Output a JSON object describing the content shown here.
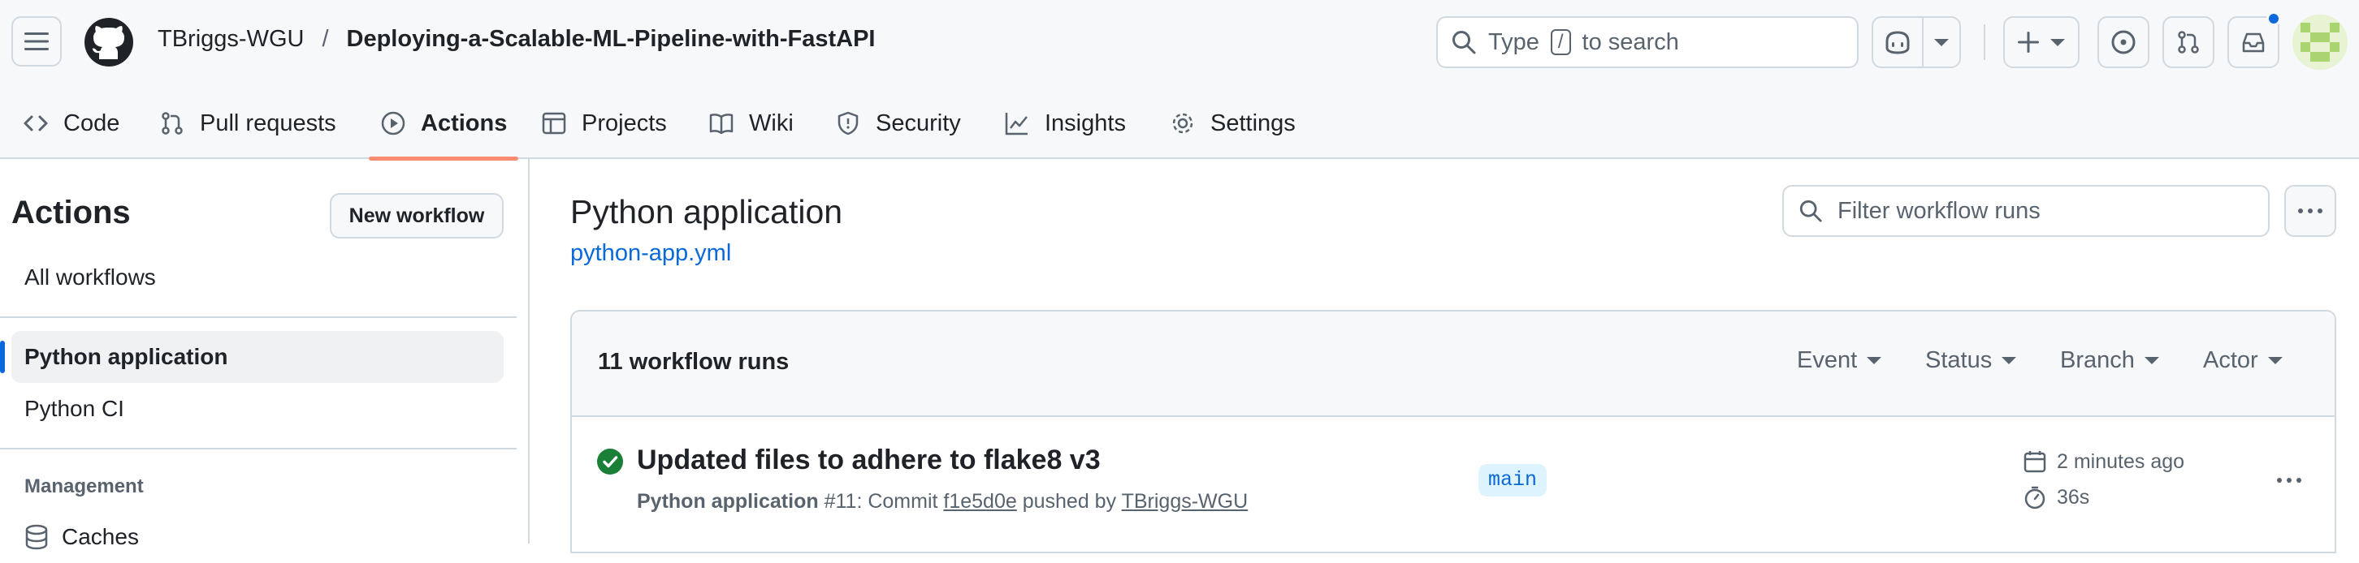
{
  "header": {
    "owner": "TBriggs-WGU",
    "separator": "/",
    "repo": "Deploying-a-Scalable-ML-Pipeline-with-FastAPI",
    "search": {
      "prefix": "Type",
      "key": "/",
      "suffix": "to search"
    }
  },
  "tabs": [
    {
      "label": "Code"
    },
    {
      "label": "Pull requests"
    },
    {
      "label": "Actions"
    },
    {
      "label": "Projects"
    },
    {
      "label": "Wiki"
    },
    {
      "label": "Security"
    },
    {
      "label": "Insights"
    },
    {
      "label": "Settings"
    }
  ],
  "sidebar": {
    "title": "Actions",
    "new_workflow": "New workflow",
    "all_workflows": "All workflows",
    "workflows": [
      {
        "label": "Python application"
      },
      {
        "label": "Python CI"
      }
    ],
    "management_heading": "Management",
    "caches": "Caches"
  },
  "main": {
    "title": "Python application",
    "file_link": "python-app.yml",
    "filter_placeholder": "Filter workflow runs",
    "runs_count": "11 workflow runs",
    "filters": [
      {
        "label": "Event"
      },
      {
        "label": "Status"
      },
      {
        "label": "Branch"
      },
      {
        "label": "Actor"
      }
    ],
    "run": {
      "title": "Updated files to adhere to flake8 v3",
      "workflow": "Python application",
      "number": "#11",
      "commit_prefix": ": Commit",
      "commit": "f1e5d0e",
      "pushed_by": "pushed by",
      "actor": "TBriggs-WGU",
      "branch": "main",
      "time": "2 minutes ago",
      "duration": "36s",
      "status_color": "#1a7f37"
    }
  },
  "colors": {
    "accent_link": "#0969da",
    "selected_tab_underline": "#fd8c73",
    "notification_dot": "#0969da"
  }
}
